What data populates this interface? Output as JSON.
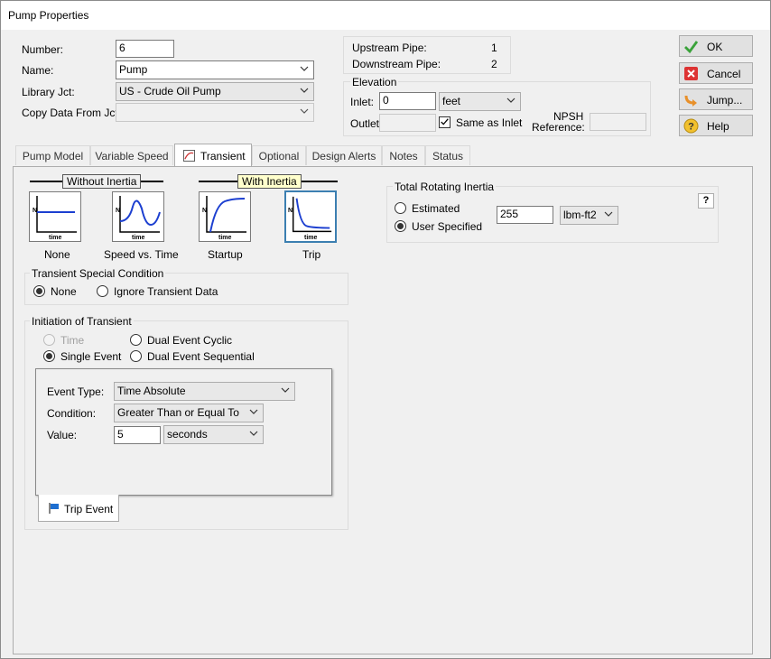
{
  "window": {
    "title": "Pump Properties"
  },
  "fields": {
    "number_label": "Number:",
    "number_value": "6",
    "name_label": "Name:",
    "name_value": "Pump",
    "library_label": "Library Jct:",
    "library_value": "US - Crude Oil Pump",
    "copy_label": "Copy Data From Jct...",
    "copy_value": ""
  },
  "pipes": {
    "upstream_label": "Upstream Pipe:",
    "upstream_value": "1",
    "downstream_label": "Downstream Pipe:",
    "downstream_value": "2"
  },
  "elevation": {
    "title": "Elevation",
    "inlet_label": "Inlet:",
    "inlet_value": "0",
    "unit": "feet",
    "outlet_label": "Outlet:",
    "outlet_value": "",
    "same_as_inlet_label": "Same as Inlet",
    "same_as_inlet_checked": true,
    "npsh_label": "NPSH",
    "reference_label": "Reference:",
    "reference_value": ""
  },
  "buttons": {
    "ok": "OK",
    "cancel": "Cancel",
    "jump": "Jump...",
    "help": "Help"
  },
  "tabs": [
    {
      "label": "Pump Model"
    },
    {
      "label": "Variable Speed"
    },
    {
      "label": "Transient",
      "active": true
    },
    {
      "label": "Optional"
    },
    {
      "label": "Design Alerts"
    },
    {
      "label": "Notes"
    },
    {
      "label": "Status"
    }
  ],
  "transient": {
    "without_inertia_label": "Without Inertia",
    "with_inertia_label": "With Inertia",
    "graph_axis_y": "N",
    "graph_axis_x": "time",
    "graphs": [
      {
        "label": "None"
      },
      {
        "label": "Speed vs. Time"
      },
      {
        "label": "Startup"
      },
      {
        "label": "Trip",
        "selected": true
      }
    ],
    "special_condition": {
      "title": "Transient Special Condition",
      "options": [
        "None",
        "Ignore Transient Data"
      ],
      "selected": "None"
    },
    "initiation": {
      "title": "Initiation of Transient",
      "options": [
        "Time",
        "Single Event",
        "Dual Event Cyclic",
        "Dual Event Sequential"
      ],
      "selected": "Single Event",
      "disabled": [
        "Time"
      ]
    },
    "event": {
      "event_type_label": "Event Type:",
      "event_type_value": "Time Absolute",
      "condition_label": "Condition:",
      "condition_value": "Greater Than or Equal To",
      "value_label": "Value:",
      "value_value": "5",
      "value_unit": "seconds",
      "tab_label": "Trip Event"
    },
    "inertia": {
      "title": "Total Rotating Inertia",
      "options": [
        "Estimated",
        "User Specified"
      ],
      "selected": "User Specified",
      "value": "255",
      "unit": "lbm-ft2",
      "help_label": "?"
    }
  },
  "colors": {
    "curve": "#1c3fd0",
    "selected_border": "#3c7fb1",
    "with_inertia_bg": "#ffffcc"
  }
}
